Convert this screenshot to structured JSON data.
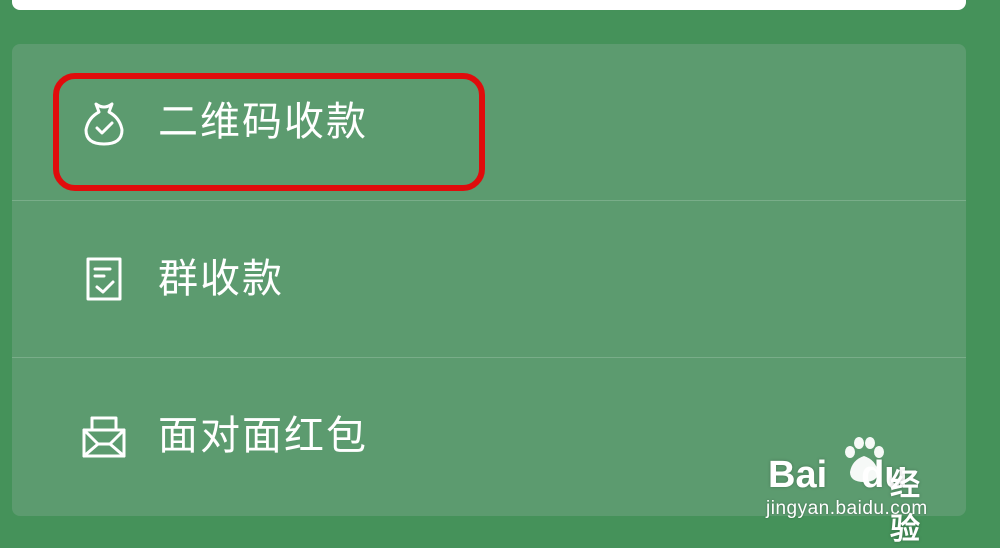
{
  "menu": {
    "items": [
      {
        "label": "二维码收款",
        "icon": "money-bag-icon"
      },
      {
        "label": "群收款",
        "icon": "group-bill-icon"
      },
      {
        "label": "面对面红包",
        "icon": "red-packet-icon"
      }
    ]
  },
  "highlight": {
    "color": "#e00c0c"
  },
  "watermark": {
    "brand_left": "Bai",
    "brand_right": "du",
    "brand_suffix": "经验",
    "url": "jingyan.baidu.com"
  },
  "colors": {
    "background": "#45925a",
    "panel": "#5c9b6f",
    "text": "#ffffff"
  }
}
